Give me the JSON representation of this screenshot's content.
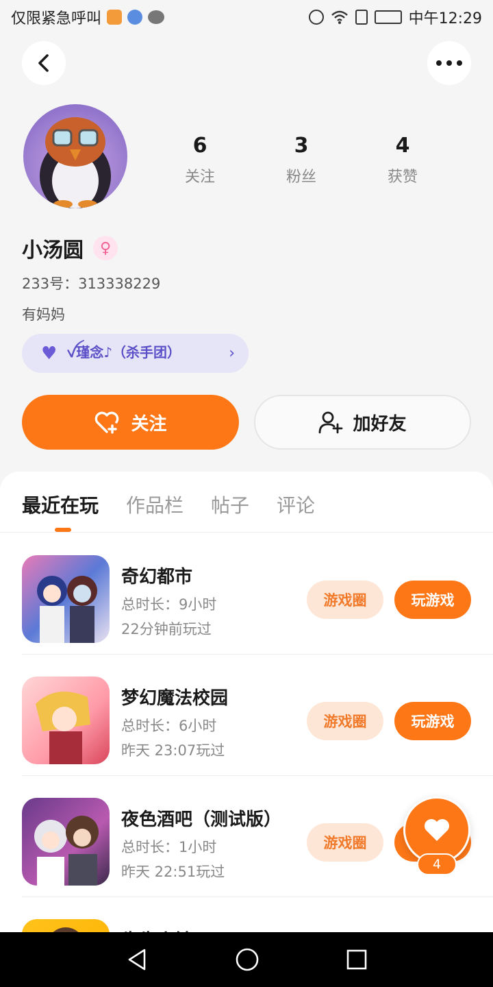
{
  "status_bar": {
    "left_text": "仅限紧急呼叫",
    "time": "中午12:29"
  },
  "profile": {
    "stats": [
      {
        "value": "6",
        "label": "关注"
      },
      {
        "value": "3",
        "label": "粉丝"
      },
      {
        "value": "4",
        "label": "获赞"
      }
    ],
    "name": "小汤圆",
    "gender_symbol": "♀",
    "uid": "233号：313338229",
    "bio": "有妈妈",
    "club": "ꪜ瑾念♪（杀手团）",
    "follow_label": "关注",
    "add_friend_label": "加好友"
  },
  "tabs": [
    "最近在玩",
    "作品栏",
    "帖子",
    "评论"
  ],
  "games": [
    {
      "title": "奇幻都市",
      "duration": "总时长：9小时",
      "last_played": "22分钟前玩过",
      "circle_label": "游戏圈",
      "play_label": "玩游戏"
    },
    {
      "title": "梦幻魔法校园",
      "duration": "总时长：6小时",
      "last_played": "昨天 23:07玩过",
      "circle_label": "游戏圈",
      "play_label": "玩游戏"
    },
    {
      "title": "夜色酒吧（测试版）",
      "duration": "总时长：1小时",
      "last_played": "昨天 22:51玩过",
      "circle_label": "游戏圈",
      "play_label": "玩游戏"
    },
    {
      "title": "牛牛小镇"
    }
  ],
  "like_float": {
    "count": "4"
  },
  "colors": {
    "accent": "#fd7717",
    "accent_light": "#fde6d6",
    "club_bg": "#e6e4f7",
    "club_text": "#5b4fc8"
  }
}
